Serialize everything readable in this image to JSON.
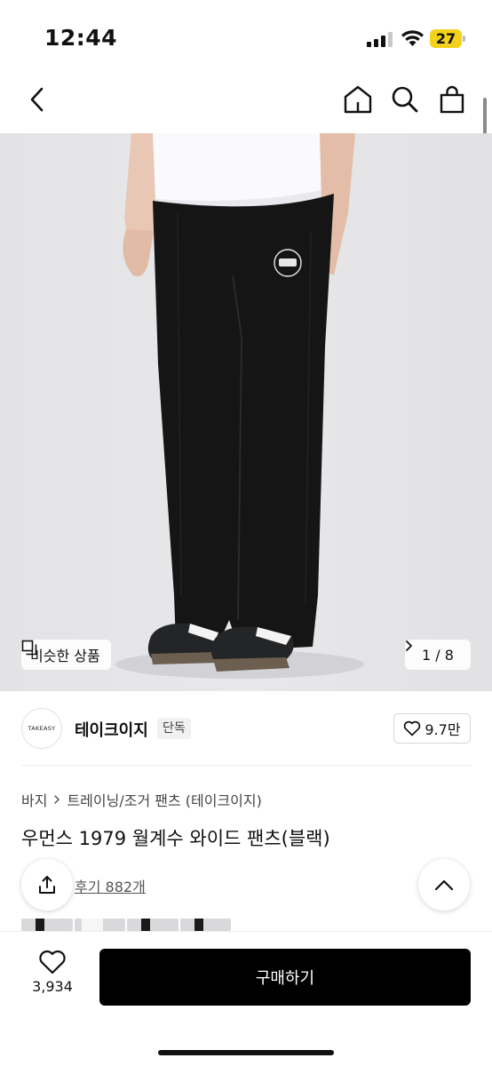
{
  "status_bar": {
    "time": "12:44",
    "battery_level": "27",
    "battery_color": "#f2d21b"
  },
  "nav": {
    "back_icon": "chevron-left-icon",
    "home_icon": "home-icon",
    "search_icon": "search-icon",
    "bag_icon": "shopping-bag-icon"
  },
  "hero": {
    "similar_label": "비슷한 상품",
    "page_indicator": "1 / 8"
  },
  "brand": {
    "logo_text": "TAKEASY",
    "name": "테이크이지",
    "badge": "단독",
    "likes": "9.7만"
  },
  "product": {
    "breadcrumb": [
      "바지",
      "트레이닝/조거 팬츠 (테이크이지)"
    ],
    "title": "우먼스 1979 월계수 와이드 팬츠(블랙)",
    "reviews": "후기 882개"
  },
  "bottom": {
    "wish_count": "3,934",
    "buy_label": "구매하기",
    "buy_color": "#000000"
  }
}
